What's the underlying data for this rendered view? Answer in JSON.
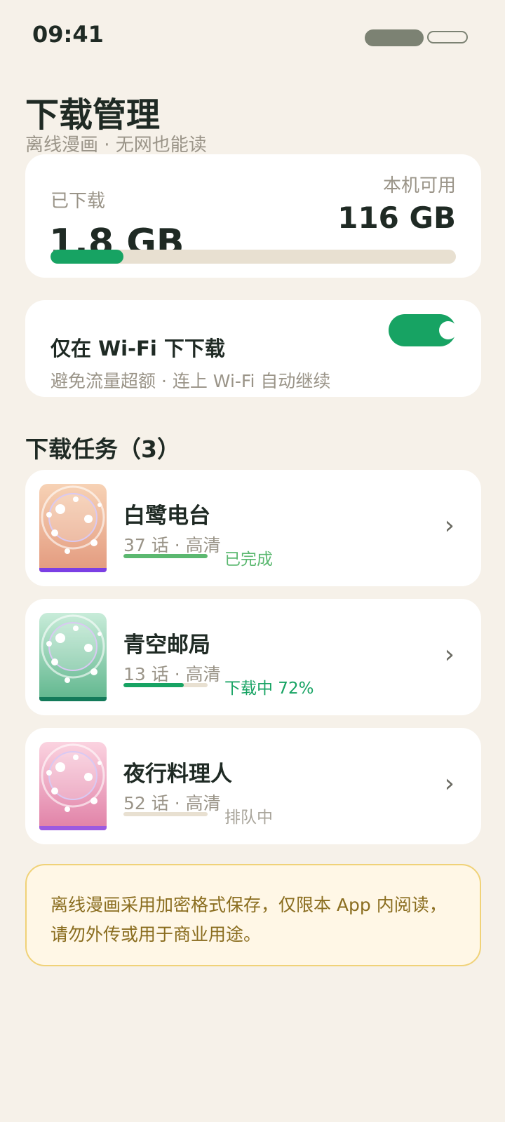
{
  "status_bar": {
    "time": "09:41"
  },
  "header": {
    "title": "下载管理",
    "subtitle": "离线漫画 · 无网也能读"
  },
  "storage": {
    "downloaded_label": "已下载",
    "downloaded_value": "1.8 GB",
    "available_label": "本机可用",
    "available_value": "116 GB",
    "used_fraction": 0.18,
    "accent": "#17a363"
  },
  "wifi": {
    "title": "仅在 Wi-Fi 下下载",
    "description": "避免流量超额 · 连上 Wi-Fi 自动继续",
    "enabled": true
  },
  "tasks_section": {
    "title": "下载任务（3）"
  },
  "tasks": [
    {
      "title": "白鹭电台",
      "meta": "37 话 · 高清",
      "status": "已完成",
      "progress": 1.0,
      "status_color": "#5bb870",
      "fill_color": "#5bb870",
      "cover_colors": [
        "#f7d2b5",
        "#e39a7e"
      ],
      "cover_bar": "#7b3fe4"
    },
    {
      "title": "青空邮局",
      "meta": "13 话 · 高清",
      "status": "下载中 72%",
      "progress": 0.72,
      "status_color": "#17a363",
      "fill_color": "#17a363",
      "cover_colors": [
        "#c8ecd9",
        "#5fb68d"
      ],
      "cover_bar": "#137a5a"
    },
    {
      "title": "夜行料理人",
      "meta": "52 话 · 高清",
      "status": "排队中",
      "progress": 0.0,
      "status_color": "#a9a59b",
      "fill_color": "#e8e0d1",
      "cover_colors": [
        "#fbd3e0",
        "#e080a6"
      ],
      "cover_bar": "#9b5ae0"
    }
  ],
  "notice": {
    "text": "离线漫画采用加密格式保存，仅限本 App 内阅读，请勿外传或用于商业用途。"
  }
}
